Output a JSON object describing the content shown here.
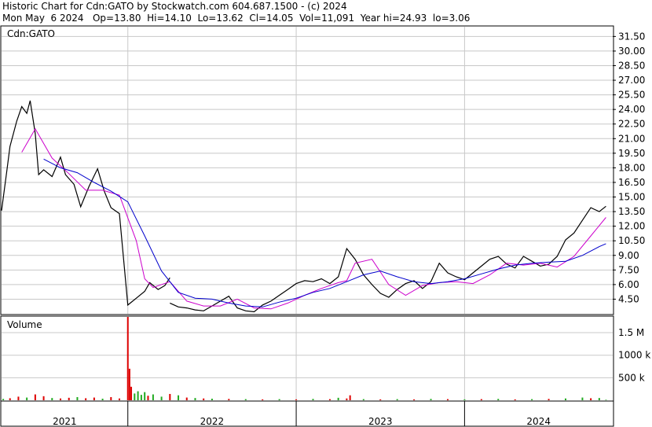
{
  "header": {
    "line1": "Historic Chart for Cdn:GATO by Stockwatch.com 604.687.1500 - (c) 2024",
    "line2": "Mon May  6 2024   Op=13.80  Hi=14.10  Lo=13.62  Cl=14.05  Vol=11,091  Year hi=24.93  lo=3.06"
  },
  "price_panel": {
    "label": "Cdn:GATO"
  },
  "volume_panel": {
    "label": "Volume"
  },
  "colors": {
    "price": "#000000",
    "ma_short": "#cc00cc",
    "ma_long": "#0000cc",
    "vol_up": "#22aa22",
    "vol_down": "#dd0000",
    "grid": "#c8c8c8"
  },
  "chart_data": [
    {
      "type": "line",
      "title": "Cdn:GATO",
      "x_ticks": [
        "2021",
        "2022",
        "2023",
        "2024"
      ],
      "y_ticks": [
        "31.50",
        "30.00",
        "28.50",
        "27.00",
        "25.50",
        "24.00",
        "22.50",
        "21.00",
        "19.50",
        "18.00",
        "16.50",
        "15.00",
        "13.50",
        "12.00",
        "10.50",
        "9.00",
        "7.50",
        "6.00",
        "4.50"
      ],
      "ylim": [
        3.0,
        32.5
      ],
      "xlim": [
        2020.75,
        2024.38
      ],
      "grid": true,
      "series": [
        {
          "x": [
            2020.75,
            2020.78,
            2020.8,
            2020.84,
            2020.87,
            2020.9,
            2020.92,
            2020.95,
            2020.97,
            2021.0,
            2021.05,
            2021.1,
            2021.13,
            2021.18,
            2021.22,
            2021.27,
            2021.32,
            2021.36,
            2021.4,
            2021.45,
            2021.5,
            2021.55,
            2021.6,
            2021.63,
            2021.68,
            2021.72,
            2021.75,
            2021.75,
            2021.8,
            2021.85,
            2021.9,
            2021.95,
            2022.0,
            2022.05,
            2022.1,
            2022.15,
            2022.2,
            2022.25,
            2022.3,
            2022.35,
            2022.4,
            2022.45,
            2022.5,
            2022.55,
            2022.6,
            2022.65,
            2022.7,
            2022.75,
            2022.8,
            2022.85,
            2022.9,
            2022.95,
            2023.0,
            2023.05,
            2023.1,
            2023.15,
            2023.2,
            2023.25,
            2023.3,
            2023.35,
            2023.4,
            2023.45,
            2023.5,
            2023.55,
            2023.6,
            2023.65,
            2023.7,
            2023.75,
            2023.8,
            2023.85,
            2023.9,
            2023.95,
            2024.0,
            2024.05,
            2024.1,
            2024.15,
            2024.2,
            2024.25,
            2024.3,
            2024.34
          ],
          "values": [
            13.6,
            17.5,
            20.2,
            22.8,
            24.3,
            23.6,
            24.9,
            21.5,
            17.3,
            17.8,
            17.1,
            19.1,
            17.3,
            16.3,
            14.0,
            16.1,
            17.9,
            15.6,
            13.9,
            13.3,
            3.9,
            4.6,
            5.3,
            6.2,
            5.5,
            5.9,
            6.7,
            4.1,
            3.7,
            3.6,
            3.4,
            3.3,
            3.8,
            4.3,
            4.8,
            3.6,
            3.3,
            3.2,
            3.9,
            4.3,
            4.9,
            5.5,
            6.1,
            6.4,
            6.3,
            6.6,
            6.1,
            6.8,
            9.7,
            8.6,
            7.0,
            6.0,
            5.1,
            4.7,
            5.5,
            6.1,
            6.4,
            5.6,
            6.3,
            8.2,
            7.2,
            6.8,
            6.5,
            7.2,
            7.9,
            8.6,
            8.9,
            8.1,
            7.7,
            8.9,
            8.4,
            7.9,
            8.1,
            8.9,
            10.6,
            11.3,
            12.6,
            13.9,
            13.5,
            14.05
          ]
        },
        {
          "x": [
            2020.87,
            2020.95,
            2021.05,
            2021.15,
            2021.25,
            2021.35,
            2021.45,
            2021.55,
            2021.6,
            2021.65,
            2021.75,
            2021.85,
            2021.95,
            2022.05,
            2022.15,
            2022.25,
            2022.35,
            2022.45,
            2022.55,
            2022.65,
            2022.75,
            2022.8,
            2022.85,
            2022.95,
            2023.05,
            2023.15,
            2023.25,
            2023.35,
            2023.45,
            2023.55,
            2023.65,
            2023.75,
            2023.85,
            2023.95,
            2024.05,
            2024.15,
            2024.25,
            2024.34
          ],
          "values": [
            19.6,
            22.0,
            19.0,
            17.4,
            15.7,
            15.7,
            15.2,
            10.5,
            6.6,
            5.7,
            6.3,
            4.3,
            3.8,
            3.8,
            4.5,
            3.6,
            3.5,
            4.1,
            4.9,
            5.6,
            6.2,
            6.4,
            8.2,
            8.6,
            6.0,
            4.9,
            5.9,
            6.2,
            6.3,
            6.1,
            7.0,
            8.2,
            8.0,
            8.2,
            7.8,
            8.9,
            11.0,
            12.9
          ]
        },
        {
          "x": [
            2021.0,
            2021.1,
            2021.2,
            2021.3,
            2021.4,
            2021.5,
            2021.6,
            2021.7,
            2021.8,
            2021.9,
            2022.0,
            2022.1,
            2022.2,
            2022.3,
            2022.4,
            2022.5,
            2022.6,
            2022.7,
            2022.8,
            2022.9,
            2023.0,
            2023.1,
            2023.2,
            2023.3,
            2023.4,
            2023.5,
            2023.6,
            2023.7,
            2023.8,
            2023.9,
            2024.0,
            2024.1,
            2024.2,
            2024.3,
            2024.34
          ],
          "values": [
            18.9,
            18.0,
            17.5,
            16.5,
            15.6,
            14.5,
            11.0,
            7.4,
            5.2,
            4.6,
            4.5,
            4.1,
            3.8,
            3.7,
            4.2,
            4.6,
            5.2,
            5.6,
            6.3,
            7.0,
            7.4,
            6.8,
            6.3,
            6.1,
            6.3,
            6.6,
            7.1,
            7.6,
            8.0,
            8.2,
            8.3,
            8.4,
            9.0,
            9.9,
            10.2
          ]
        }
      ]
    },
    {
      "type": "bar",
      "title": "Volume",
      "y_ticks": [
        "1.5 M",
        "1000 k",
        "500 k"
      ],
      "ylim": [
        0,
        1850000
      ],
      "xlim": [
        2020.75,
        2024.38
      ],
      "grid": true,
      "bars": [
        {
          "x": 2020.76,
          "v": 30000,
          "up": true
        },
        {
          "x": 2020.8,
          "v": 45000,
          "up": false
        },
        {
          "x": 2020.85,
          "v": 80000,
          "up": false
        },
        {
          "x": 2020.9,
          "v": 60000,
          "up": true
        },
        {
          "x": 2020.95,
          "v": 130000,
          "up": false
        },
        {
          "x": 2021.0,
          "v": 90000,
          "up": false
        },
        {
          "x": 2021.05,
          "v": 50000,
          "up": true
        },
        {
          "x": 2021.1,
          "v": 40000,
          "up": false
        },
        {
          "x": 2021.15,
          "v": 55000,
          "up": false
        },
        {
          "x": 2021.2,
          "v": 70000,
          "up": true
        },
        {
          "x": 2021.25,
          "v": 45000,
          "up": false
        },
        {
          "x": 2021.3,
          "v": 60000,
          "up": false
        },
        {
          "x": 2021.35,
          "v": 35000,
          "up": true
        },
        {
          "x": 2021.4,
          "v": 70000,
          "up": false
        },
        {
          "x": 2021.45,
          "v": 40000,
          "up": false
        },
        {
          "x": 2021.5,
          "v": 1850000,
          "up": false
        },
        {
          "x": 2021.51,
          "v": 700000,
          "up": false
        },
        {
          "x": 2021.52,
          "v": 300000,
          "up": false
        },
        {
          "x": 2021.54,
          "v": 150000,
          "up": true
        },
        {
          "x": 2021.56,
          "v": 200000,
          "up": true
        },
        {
          "x": 2021.58,
          "v": 120000,
          "up": true
        },
        {
          "x": 2021.6,
          "v": 180000,
          "up": true
        },
        {
          "x": 2021.62,
          "v": 100000,
          "up": false
        },
        {
          "x": 2021.65,
          "v": 130000,
          "up": true
        },
        {
          "x": 2021.7,
          "v": 80000,
          "up": true
        },
        {
          "x": 2021.75,
          "v": 140000,
          "up": false
        },
        {
          "x": 2021.8,
          "v": 110000,
          "up": true
        },
        {
          "x": 2021.85,
          "v": 60000,
          "up": false
        },
        {
          "x": 2021.9,
          "v": 50000,
          "up": true
        },
        {
          "x": 2021.95,
          "v": 40000,
          "up": false
        },
        {
          "x": 2022.0,
          "v": 35000,
          "up": true
        },
        {
          "x": 2022.1,
          "v": 30000,
          "up": false
        },
        {
          "x": 2022.2,
          "v": 25000,
          "up": true
        },
        {
          "x": 2022.3,
          "v": 20000,
          "up": false
        },
        {
          "x": 2022.4,
          "v": 25000,
          "up": true
        },
        {
          "x": 2022.5,
          "v": 20000,
          "up": false
        },
        {
          "x": 2022.6,
          "v": 30000,
          "up": true
        },
        {
          "x": 2022.7,
          "v": 25000,
          "up": false
        },
        {
          "x": 2022.75,
          "v": 55000,
          "up": true
        },
        {
          "x": 2022.8,
          "v": 40000,
          "up": false
        },
        {
          "x": 2022.82,
          "v": 110000,
          "up": false
        },
        {
          "x": 2022.9,
          "v": 25000,
          "up": true
        },
        {
          "x": 2023.0,
          "v": 20000,
          "up": false
        },
        {
          "x": 2023.1,
          "v": 25000,
          "up": true
        },
        {
          "x": 2023.2,
          "v": 20000,
          "up": false
        },
        {
          "x": 2023.3,
          "v": 30000,
          "up": true
        },
        {
          "x": 2023.4,
          "v": 25000,
          "up": false
        },
        {
          "x": 2023.5,
          "v": 20000,
          "up": true
        },
        {
          "x": 2023.6,
          "v": 25000,
          "up": false
        },
        {
          "x": 2023.7,
          "v": 30000,
          "up": true
        },
        {
          "x": 2023.8,
          "v": 20000,
          "up": false
        },
        {
          "x": 2023.9,
          "v": 25000,
          "up": true
        },
        {
          "x": 2024.0,
          "v": 30000,
          "up": false
        },
        {
          "x": 2024.1,
          "v": 40000,
          "up": true
        },
        {
          "x": 2024.2,
          "v": 60000,
          "up": true
        },
        {
          "x": 2024.25,
          "v": 45000,
          "up": false
        },
        {
          "x": 2024.3,
          "v": 50000,
          "up": true
        },
        {
          "x": 2024.34,
          "v": 11091,
          "up": true
        }
      ]
    }
  ]
}
